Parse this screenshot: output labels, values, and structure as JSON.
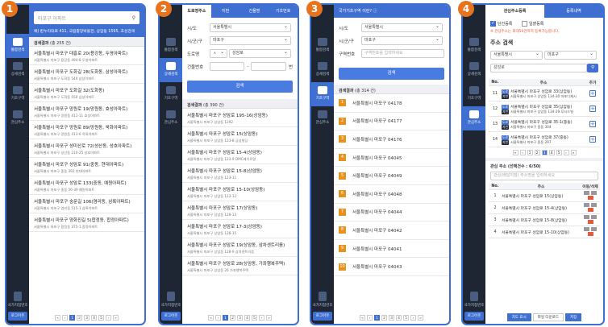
{
  "badges": [
    "1",
    "2",
    "3",
    "4"
  ],
  "sidebar": {
    "items": [
      "통합검색",
      "상세검색",
      "기초구역",
      "관심주소"
    ],
    "bottom": "국가지점번호",
    "logout": "로그아웃"
  },
  "p1": {
    "search_placeholder": "마포구 아파트",
    "hint": "예) 판누리대로 411, 국립중앙박물관, 상암동 1595, 초성검색",
    "count_label": "검색결과",
    "count": "(총 255 건)",
    "items": [
      {
        "t": "서울특별시 마포구 대흥로 20(용강동, 두영아파트)",
        "s": "서울특별시 마포구 용강동 494-8 두영아파트"
      },
      {
        "t": "서울특별시 마포구 도화길 28(도화동, 삼성아파트)",
        "s": "서울특별시 마포구 도화동 540 삼성아파트"
      },
      {
        "t": "서울특별시 마포구 도화길 32(도화동)",
        "s": "서울특별시 마포구 도화동 550 삼성아파트"
      },
      {
        "t": "서울특별시 마포구 망원로 19(망원동, 효성아파트)",
        "s": "서울특별시 마포구 망원동 411-11 효성아파트"
      },
      {
        "t": "서울특별시 마포구 망원로 89(망원동, 욱화아파트)",
        "s": "서울특별시 마포구 망원동 413-6 욱화아파트"
      },
      {
        "t": "서울특별시 마포구 성미산로 72(성산동, 성호아파트)",
        "s": "서울특별시 마포구 성산동 210-25 성호아파트"
      },
      {
        "t": "서울특별시 마포구 성암로 91(중동, 현대아파트)",
        "s": "서울특별시 마포구 중동 392 현대아파트"
      },
      {
        "t": "서울특별시 마포구 성암로 133(중동, 예원아파트)",
        "s": "서울특별시 마포구 중동 56-39 예원아파트"
      },
      {
        "t": "서울특별시 마포구 숭문길 106(염리동, 삼록아파트)",
        "s": "서울특별시 마포구 염리동 515-1 삼록아파트"
      },
      {
        "t": "서울특별시 마포구 양화진길 5(합정동, 합정아파트)",
        "s": "서울특별시 마포구 합정동 375-1 합정아파트"
      }
    ],
    "pages": [
      "«",
      "‹",
      "1",
      "2",
      "3",
      "4",
      "5",
      "›",
      "»"
    ]
  },
  "p2": {
    "tabs": [
      "도로명주소",
      "지번",
      "건물명",
      "기초번호"
    ],
    "labels": [
      "시/도",
      "시/군/구",
      "도로명",
      "건물번호"
    ],
    "sido": "서울특별시",
    "sigungu": "마포구",
    "road_prefix": "ㅅ",
    "road": "성암로",
    "unit": "번",
    "button": "검색",
    "count_label": "검색결과",
    "count": "(총 390 건)",
    "items": [
      {
        "t": "서울특별시 마포구 성암로 195-16(상암동)",
        "s": "서울특별시 마포구 상암동 1292"
      },
      {
        "t": "서울특별시 마포구 성암로 15(상암동)",
        "s": "서울특별시 마포구 상암동 123-8 금성빌딩"
      },
      {
        "t": "서울특별시 마포구 성암로 15-4(상암동)",
        "s": "서울특별시 마포구 상암동 123-9 DMC베이로얄"
      },
      {
        "t": "서울특별시 마포구 성암로 15-8(상암동)",
        "s": "서울특별시 마포구 상암동 123-11"
      },
      {
        "t": "서울특별시 마포구 성암로 15-10(상암동)",
        "s": "서울특별시 마포구 상암동 123-12"
      },
      {
        "t": "서울특별시 마포구 성암로 17(상암동)",
        "s": "서울특별시 마포구 상암동 128-13"
      },
      {
        "t": "서울특별시 마포구 성암로 17-3(상암동)",
        "s": "서울특별시 마포구 상암동 128-15"
      },
      {
        "t": "서울특별시 마포구 성암로 19(상암동, 삼차센트리움)",
        "s": "서울특별시 마포구 상암동 128-9 삼차센트리움"
      },
      {
        "t": "서울특별시 마포구 성암로 28(상암동, 가좌행복주택)",
        "s": "서울특별시 마포구 상암동 26 가좌행복주택"
      }
    ],
    "pages": [
      "«",
      "‹",
      "1",
      "2",
      "3",
      "4",
      "5",
      "›",
      "»"
    ]
  },
  "p3": {
    "title": "국가기초구역 이란?",
    "labels": [
      "시/도",
      "시/군/구",
      "구역번호"
    ],
    "sido": "서울특별시",
    "sigungu": "마포구",
    "placeholder": "구역번호를 입력하세요",
    "button": "검색",
    "count_label": "검색결과",
    "count": "(총 314 건)",
    "items": [
      {
        "n": "1",
        "t": "서울특별시 마포구 04178"
      },
      {
        "n": "2",
        "t": "서울특별시 마포구 04177"
      },
      {
        "n": "3",
        "t": "서울특별시 마포구 04176"
      },
      {
        "n": "4",
        "t": "서울특별시 마포구 04045"
      },
      {
        "n": "5",
        "t": "서울특별시 마포구 04049"
      },
      {
        "n": "6",
        "t": "서울특별시 마포구 04048"
      },
      {
        "n": "7",
        "t": "서울특별시 마포구 04044"
      },
      {
        "n": "8",
        "t": "서울특별시 마포구 04042"
      },
      {
        "n": "9",
        "t": "서울특별시 마포구 04041"
      },
      {
        "n": "10",
        "t": "서울특별시 마포구 04043"
      }
    ],
    "pages": [
      "«",
      "‹",
      "1",
      "2",
      "3",
      "4",
      "5",
      "›",
      "»"
    ]
  },
  "p4": {
    "tabs": [
      "관심주소등록",
      "등록내역"
    ],
    "opt1": "단건등록",
    "opt2": "일괄등록",
    "note": "※ 관심주소는 최대50건까지 등록가능합니다.",
    "section": "주소 검색",
    "sido": "서울특별시",
    "sigungu": "마포구",
    "query": "성암로",
    "th": [
      "No.",
      "주소",
      "추가"
    ],
    "tag_road": "도로",
    "tag_lot": "지번",
    "rows": [
      {
        "n": "11",
        "a": "서울특별시 마포구 성암로 33(상암동)",
        "b": "서울특별시 마포구 상암동 134-30 마포디제시"
      },
      {
        "n": "12",
        "a": "서울특별시 마포구 성암로 35(상암동)",
        "b": "서울특별시 마포구 상암동 134-29 푸시드빌"
      },
      {
        "n": "13",
        "a": "서울특별시 마포구 성암로 35-1(중동)",
        "b": "서울특별시 마포구 중동 304"
      },
      {
        "n": "14",
        "a": "서울특별시 마포구 성암로 37(중동)",
        "b": "서울특별시 마포구 중동 297"
      }
    ],
    "pages": [
      "«",
      "‹",
      "1",
      "2",
      "3",
      "4",
      "5",
      "›",
      "»"
    ],
    "fav_title": "관심 주소 (선택건수 : 6/50)",
    "fav_placeholder": "관심(배달지점) 주소명을 입력하세요",
    "fav_th": [
      "No.",
      "주소",
      "이동/삭제"
    ],
    "favs": [
      {
        "n": "1",
        "a": "서울특별시 마포구 성암로 15(상암동)"
      },
      {
        "n": "2",
        "a": "서울특별시 마포구 성암로 15-4(상암동)"
      },
      {
        "n": "3",
        "a": "서울특별시 마포구 성암로 15-8(상암동)"
      },
      {
        "n": "4",
        "a": "서울특별시 마포구 성암로 15-10(상암동)"
      }
    ],
    "foot": [
      "지도 표시",
      "파일 다운로드",
      "저장"
    ]
  }
}
